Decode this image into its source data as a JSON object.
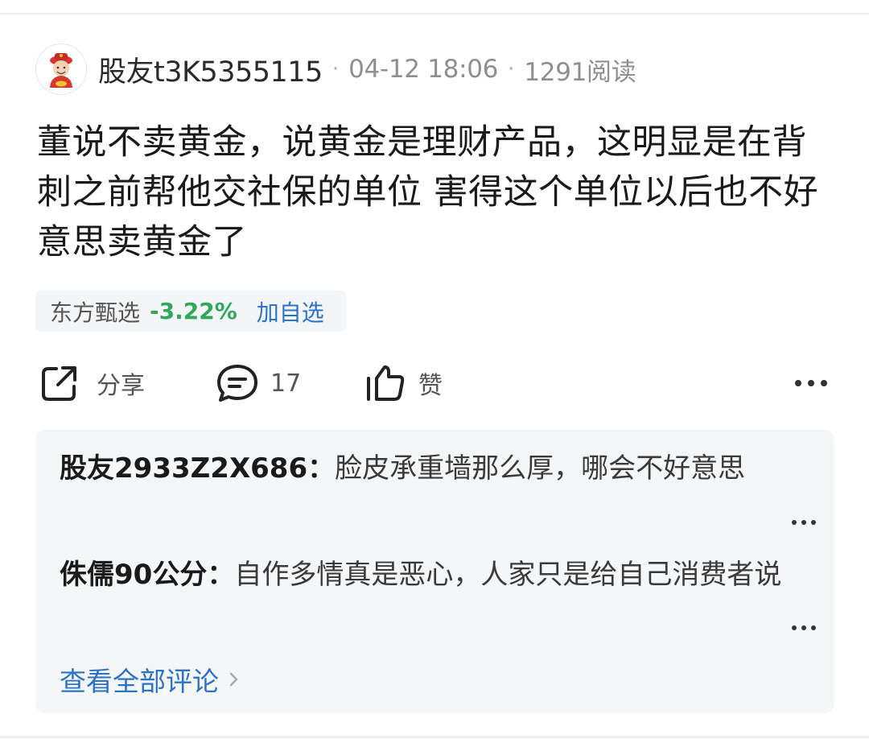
{
  "post": {
    "author": "股友t3K5355115",
    "time": "04-12 18:06",
    "views": "1291阅读",
    "text": "董说不卖黄金，说黄金是理财产品，这明显是在背刺之前帮他交社保的单位  害得这个单位以后也不好意思卖黄金了"
  },
  "stock": {
    "name": "东方甄选",
    "change": "-3.22%",
    "add_label": "加自选",
    "change_color": "#2fa85a"
  },
  "actions": {
    "share_label": "分享",
    "comment_count": "17",
    "like_label": "赞"
  },
  "comments": {
    "items": [
      {
        "user": "股友2933Z2X686：",
        "text": "脸皮承重墙那么厚，哪会不好意思"
      },
      {
        "user": "侏儒90公分：",
        "text": "自作多情真是恶心，人家只是给自己消费者说"
      }
    ],
    "view_all_label": "查看全部评论"
  },
  "icons": [
    "avatar-caishen-icon",
    "share-icon",
    "comment-icon",
    "like-icon",
    "more-icon",
    "chevron-right-icon"
  ]
}
